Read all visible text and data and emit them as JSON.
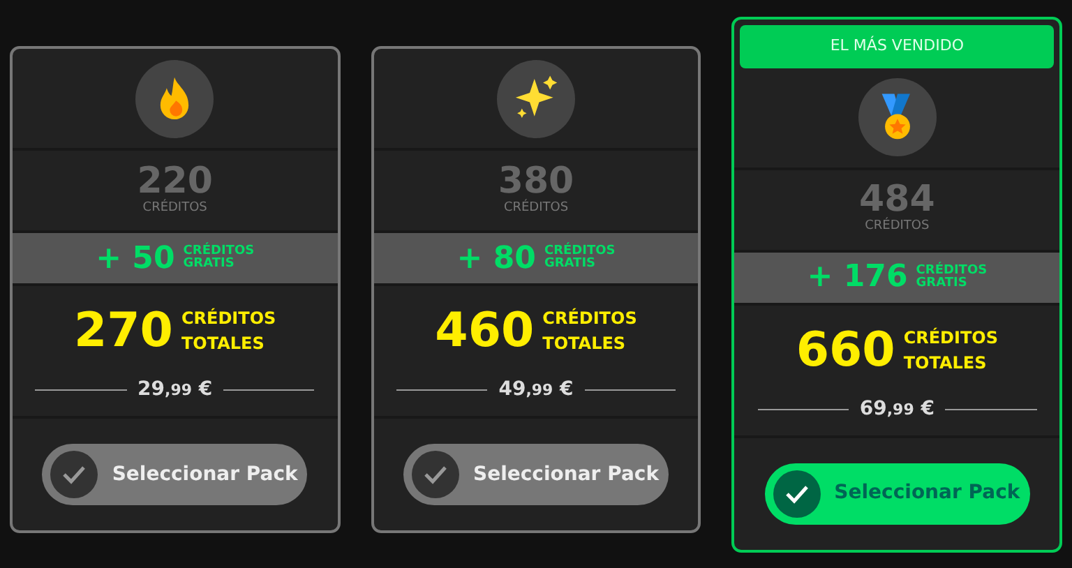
{
  "packs": [
    {
      "kind": "flame",
      "featured": false,
      "base": "220",
      "base_label": "CRÉDITOS",
      "bonus": "+ 50",
      "bonus_label_1": "CRÉDITOS",
      "bonus_label_2": "GRATIS",
      "total": "270",
      "total_label_1": "CRÉDITOS",
      "total_label_2": "TOTALES",
      "price_int": "29",
      "price_cents": ",99",
      "currency": "€",
      "button": "Seleccionar Pack"
    },
    {
      "kind": "sparkles",
      "featured": false,
      "base": "380",
      "base_label": "CRÉDITOS",
      "bonus": "+ 80",
      "bonus_label_1": "CRÉDITOS",
      "bonus_label_2": "GRATIS",
      "total": "460",
      "total_label_1": "CRÉDITOS",
      "total_label_2": "TOTALES",
      "price_int": "49",
      "price_cents": ",99",
      "currency": "€",
      "button": "Seleccionar Pack"
    },
    {
      "kind": "medal",
      "featured": true,
      "badge": "EL MÁS VENDIDO",
      "base": "484",
      "base_label": "CRÉDITOS",
      "bonus": "+ 176",
      "bonus_label_1": "CRÉDITOS",
      "bonus_label_2": "GRATIS",
      "total": "660",
      "total_label_1": "CRÉDITOS",
      "total_label_2": "TOTALES",
      "price_int": "69",
      "price_cents": ",99",
      "currency": "€",
      "button": "Seleccionar Pack"
    }
  ]
}
